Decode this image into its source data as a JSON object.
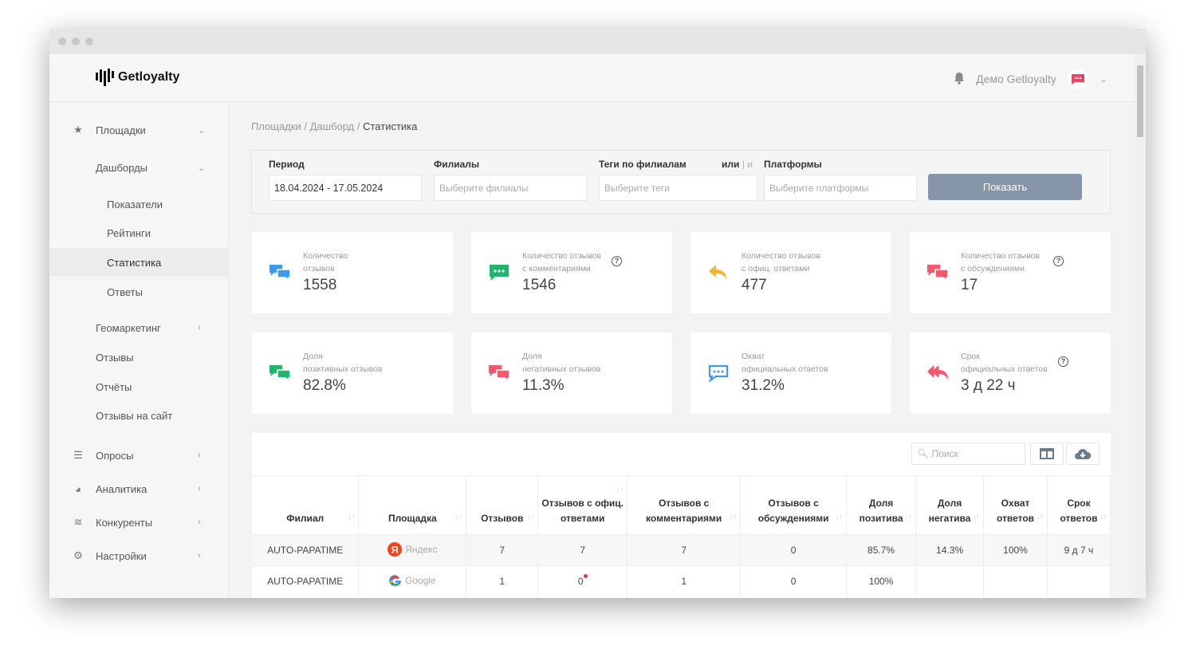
{
  "app": {
    "logo": "Getloyalty",
    "user": "Демо Getloyalty"
  },
  "sidebar": {
    "items": [
      {
        "label": "Площадки",
        "icon": "star-icon",
        "chev": "⌄"
      },
      {
        "label": "Дашборды",
        "chev": "⌄"
      },
      {
        "label": "Показатели"
      },
      {
        "label": "Рейтинги"
      },
      {
        "label": "Статистика",
        "active": true
      },
      {
        "label": "Ответы"
      },
      {
        "label": "Геомаркетинг",
        "chev": "‹"
      },
      {
        "label": "Отзывы"
      },
      {
        "label": "Отчёты"
      },
      {
        "label": "Отзывы на сайт"
      },
      {
        "label": "Опросы",
        "icon": "list-icon",
        "chev": "‹"
      },
      {
        "label": "Аналитика",
        "icon": "pie-chart-icon",
        "chev": "‹"
      },
      {
        "label": "Конкуренты",
        "icon": "layers-icon",
        "chev": "‹"
      },
      {
        "label": "Настройки",
        "icon": "gear-icon",
        "chev": "‹"
      }
    ]
  },
  "breadcrumb": [
    "Площадки",
    "Дашборд",
    "Статистика"
  ],
  "filters": {
    "period_label": "Период",
    "period_value": "18.04.2024 - 17.05.2024",
    "branches_label": "Филиалы",
    "branches_placeholder": "Выберите филиалы",
    "tags_label": "Теги по филиалам",
    "tags_mode_or": "или",
    "tags_mode_sep": "|",
    "tags_mode_and": "и",
    "tags_placeholder": "Выберите теги",
    "platforms_label": "Платформы",
    "platforms_placeholder": "Выберите платформы",
    "show_button": "Показать"
  },
  "cards": [
    {
      "l1": "Количество",
      "l2": "отзывов",
      "value": "1558",
      "color": "#3d9be9"
    },
    {
      "l1": "Количество отзывов",
      "l2": "с комментариями",
      "value": "1546",
      "color": "#1fb56b",
      "help": "?"
    },
    {
      "l1": "Количество отзывов",
      "l2": "с офиц. ответами",
      "value": "477",
      "color": "#f2b631"
    },
    {
      "l1": "Количество отзывов",
      "l2": "с обсуждениями",
      "value": "17",
      "color": "#f5576c",
      "help": "?"
    },
    {
      "l1": "Доля",
      "l2": "позитивных отзывов",
      "value": "82.8%",
      "color": "#1fb56b"
    },
    {
      "l1": "Доля",
      "l2": "негативных отзывов",
      "value": "11.3%",
      "color": "#f5576c"
    },
    {
      "l1": "Охват",
      "l2": "официальных ответов",
      "value": "31.2%",
      "color": "#3d9be9"
    },
    {
      "l1": "Срок",
      "l2": "официальных ответов",
      "value": "3 д 22 ч",
      "color": "#f5576c",
      "help": "?"
    }
  ],
  "table": {
    "search_placeholder": "Поиск",
    "columns": [
      "Филиал",
      "Площадка",
      "Отзывов",
      "Отзывов с офиц. ответами",
      "Отзывов с комментариями",
      "Отзывов с обсуждениями",
      "Доля позитива",
      "Доля негатива",
      "Охват ответов",
      "Срок ответов"
    ],
    "rows": [
      [
        "AUTO-PAPATIME",
        "Яндекс",
        "7",
        "7",
        "7",
        "0",
        "85.7%",
        "14.3%",
        "100%",
        "9 д 7 ч"
      ],
      [
        "AUTO-PAPATIME",
        "Google",
        "1",
        "0",
        "1",
        "0",
        "100%",
        "",
        "",
        ""
      ]
    ]
  }
}
